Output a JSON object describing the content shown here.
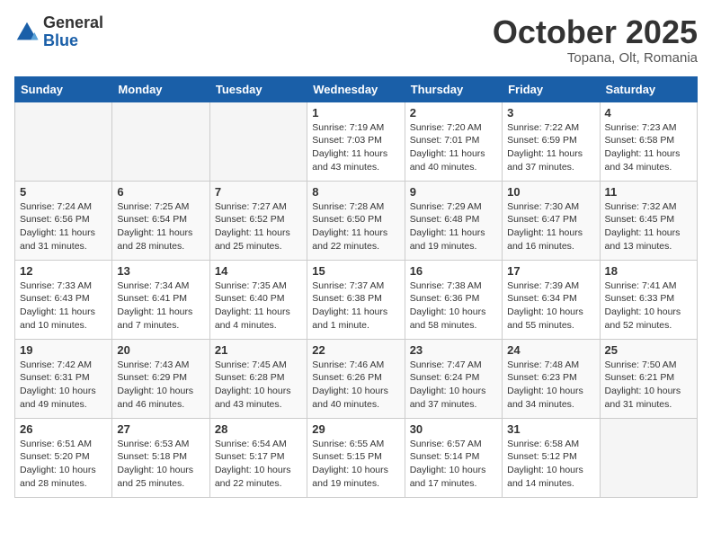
{
  "logo": {
    "general": "General",
    "blue": "Blue"
  },
  "title": "October 2025",
  "location": "Topana, Olt, Romania",
  "headers": [
    "Sunday",
    "Monday",
    "Tuesday",
    "Wednesday",
    "Thursday",
    "Friday",
    "Saturday"
  ],
  "weeks": [
    [
      {
        "num": "",
        "info": ""
      },
      {
        "num": "",
        "info": ""
      },
      {
        "num": "",
        "info": ""
      },
      {
        "num": "1",
        "info": "Sunrise: 7:19 AM\nSunset: 7:03 PM\nDaylight: 11 hours and 43 minutes."
      },
      {
        "num": "2",
        "info": "Sunrise: 7:20 AM\nSunset: 7:01 PM\nDaylight: 11 hours and 40 minutes."
      },
      {
        "num": "3",
        "info": "Sunrise: 7:22 AM\nSunset: 6:59 PM\nDaylight: 11 hours and 37 minutes."
      },
      {
        "num": "4",
        "info": "Sunrise: 7:23 AM\nSunset: 6:58 PM\nDaylight: 11 hours and 34 minutes."
      }
    ],
    [
      {
        "num": "5",
        "info": "Sunrise: 7:24 AM\nSunset: 6:56 PM\nDaylight: 11 hours and 31 minutes."
      },
      {
        "num": "6",
        "info": "Sunrise: 7:25 AM\nSunset: 6:54 PM\nDaylight: 11 hours and 28 minutes."
      },
      {
        "num": "7",
        "info": "Sunrise: 7:27 AM\nSunset: 6:52 PM\nDaylight: 11 hours and 25 minutes."
      },
      {
        "num": "8",
        "info": "Sunrise: 7:28 AM\nSunset: 6:50 PM\nDaylight: 11 hours and 22 minutes."
      },
      {
        "num": "9",
        "info": "Sunrise: 7:29 AM\nSunset: 6:48 PM\nDaylight: 11 hours and 19 minutes."
      },
      {
        "num": "10",
        "info": "Sunrise: 7:30 AM\nSunset: 6:47 PM\nDaylight: 11 hours and 16 minutes."
      },
      {
        "num": "11",
        "info": "Sunrise: 7:32 AM\nSunset: 6:45 PM\nDaylight: 11 hours and 13 minutes."
      }
    ],
    [
      {
        "num": "12",
        "info": "Sunrise: 7:33 AM\nSunset: 6:43 PM\nDaylight: 11 hours and 10 minutes."
      },
      {
        "num": "13",
        "info": "Sunrise: 7:34 AM\nSunset: 6:41 PM\nDaylight: 11 hours and 7 minutes."
      },
      {
        "num": "14",
        "info": "Sunrise: 7:35 AM\nSunset: 6:40 PM\nDaylight: 11 hours and 4 minutes."
      },
      {
        "num": "15",
        "info": "Sunrise: 7:37 AM\nSunset: 6:38 PM\nDaylight: 11 hours and 1 minute."
      },
      {
        "num": "16",
        "info": "Sunrise: 7:38 AM\nSunset: 6:36 PM\nDaylight: 10 hours and 58 minutes."
      },
      {
        "num": "17",
        "info": "Sunrise: 7:39 AM\nSunset: 6:34 PM\nDaylight: 10 hours and 55 minutes."
      },
      {
        "num": "18",
        "info": "Sunrise: 7:41 AM\nSunset: 6:33 PM\nDaylight: 10 hours and 52 minutes."
      }
    ],
    [
      {
        "num": "19",
        "info": "Sunrise: 7:42 AM\nSunset: 6:31 PM\nDaylight: 10 hours and 49 minutes."
      },
      {
        "num": "20",
        "info": "Sunrise: 7:43 AM\nSunset: 6:29 PM\nDaylight: 10 hours and 46 minutes."
      },
      {
        "num": "21",
        "info": "Sunrise: 7:45 AM\nSunset: 6:28 PM\nDaylight: 10 hours and 43 minutes."
      },
      {
        "num": "22",
        "info": "Sunrise: 7:46 AM\nSunset: 6:26 PM\nDaylight: 10 hours and 40 minutes."
      },
      {
        "num": "23",
        "info": "Sunrise: 7:47 AM\nSunset: 6:24 PM\nDaylight: 10 hours and 37 minutes."
      },
      {
        "num": "24",
        "info": "Sunrise: 7:48 AM\nSunset: 6:23 PM\nDaylight: 10 hours and 34 minutes."
      },
      {
        "num": "25",
        "info": "Sunrise: 7:50 AM\nSunset: 6:21 PM\nDaylight: 10 hours and 31 minutes."
      }
    ],
    [
      {
        "num": "26",
        "info": "Sunrise: 6:51 AM\nSunset: 5:20 PM\nDaylight: 10 hours and 28 minutes."
      },
      {
        "num": "27",
        "info": "Sunrise: 6:53 AM\nSunset: 5:18 PM\nDaylight: 10 hours and 25 minutes."
      },
      {
        "num": "28",
        "info": "Sunrise: 6:54 AM\nSunset: 5:17 PM\nDaylight: 10 hours and 22 minutes."
      },
      {
        "num": "29",
        "info": "Sunrise: 6:55 AM\nSunset: 5:15 PM\nDaylight: 10 hours and 19 minutes."
      },
      {
        "num": "30",
        "info": "Sunrise: 6:57 AM\nSunset: 5:14 PM\nDaylight: 10 hours and 17 minutes."
      },
      {
        "num": "31",
        "info": "Sunrise: 6:58 AM\nSunset: 5:12 PM\nDaylight: 10 hours and 14 minutes."
      },
      {
        "num": "",
        "info": ""
      }
    ]
  ]
}
